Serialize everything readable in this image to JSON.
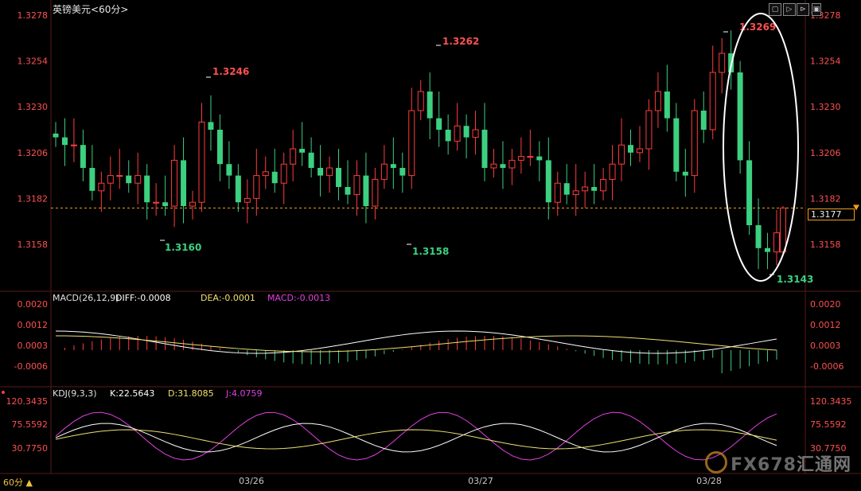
{
  "window": {
    "title": "英镑美元",
    "period_label": "<60分>"
  },
  "controls": [
    "▢",
    "▷",
    "⊳",
    "▣"
  ],
  "price_axis": {
    "ticks": [
      "1.3278",
      "1.3254",
      "1.3230",
      "1.3206",
      "1.3182",
      "1.3158"
    ]
  },
  "current_price": "1.3177",
  "annotations": {
    "high1": "1.3246",
    "high2": "1.3262",
    "high3": "1.3269",
    "low1": "1.3160",
    "low2": "1.3158",
    "low3": "1.3143"
  },
  "macd": {
    "label": "MACD(26,12,9)",
    "diff": "DIFF:-0.0008",
    "dea": "DEA:-0.0001",
    "macd": "MACD:-0.0013",
    "ticks": [
      "0.0020",
      "0.0012",
      "0.0003",
      "-0.0006"
    ]
  },
  "kdj": {
    "label": "KDJ(9,3,3)",
    "k": "K:22.5643",
    "d": "D:31.8085",
    "j": "J:4.0759",
    "ticks": [
      "120.3435",
      "75.5592",
      "30.7750"
    ]
  },
  "dates": [
    "03/26",
    "03/27",
    "03/28"
  ],
  "timeframe": "60分 ▲",
  "watermark": {
    "latin": "FX678",
    "chinese": "汇通网"
  },
  "colors": {
    "up": "#ff3c3c",
    "down": "#3cd080",
    "axis_red": "#ff5050",
    "ema": "#f0e070",
    "diff": "#ffffff",
    "j": "#e040e0",
    "dashed": "#f0a020"
  }
}
